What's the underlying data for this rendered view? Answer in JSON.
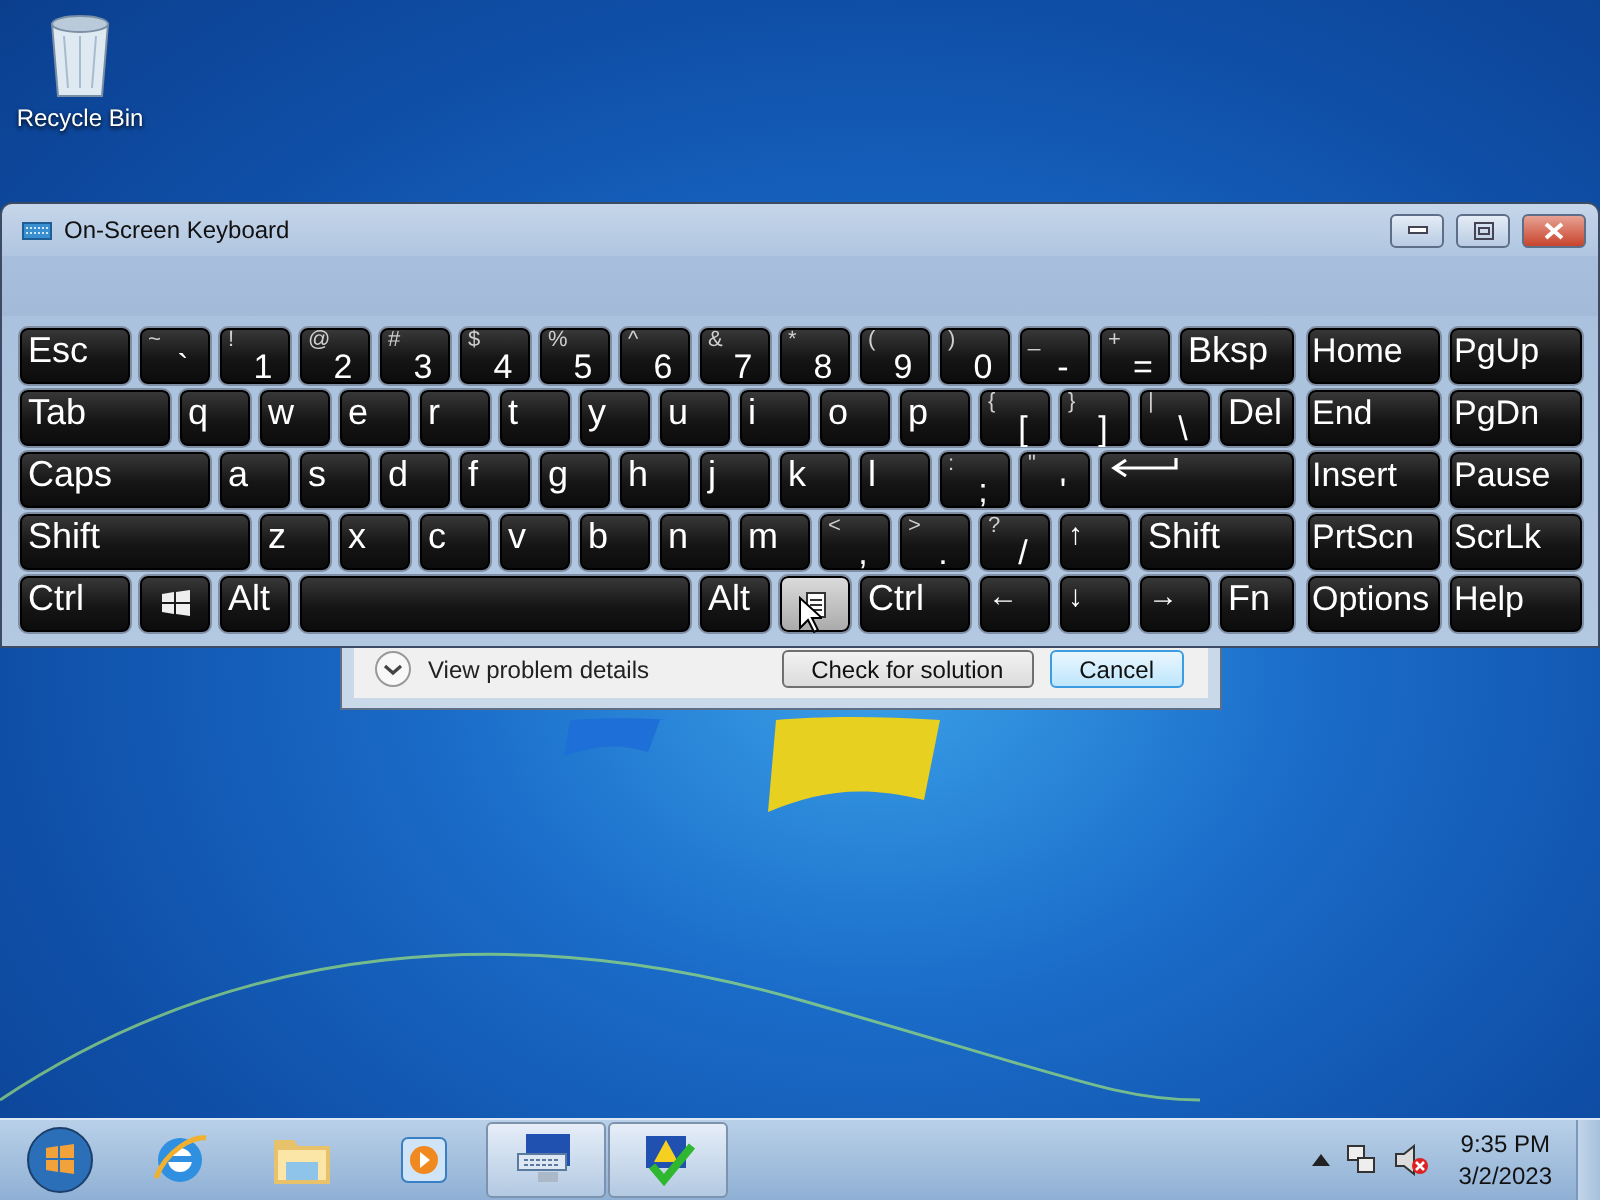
{
  "desktop_icons": [
    {
      "label": "Recycle Bin"
    }
  ],
  "keyboard_window": {
    "title": "On-Screen Keyboard",
    "key_rows": [
      {
        "keys": [
          {
            "kind": "text",
            "label": "Esc",
            "hovered": false
          },
          {
            "kind": "dual",
            "top": "~",
            "label": "`",
            "hovered": false
          },
          {
            "kind": "dual",
            "top": "!",
            "label": "1",
            "hovered": false
          },
          {
            "kind": "dual",
            "top": "@",
            "label": "2",
            "hovered": false
          },
          {
            "kind": "dual",
            "top": "#",
            "label": "3",
            "hovered": false
          },
          {
            "kind": "dual",
            "top": "$",
            "label": "4",
            "hovered": false
          },
          {
            "kind": "dual",
            "top": "%",
            "label": "5",
            "hovered": false
          },
          {
            "kind": "dual",
            "top": "^",
            "label": "6",
            "hovered": false
          },
          {
            "kind": "dual",
            "top": "&",
            "label": "7",
            "hovered": false
          },
          {
            "kind": "dual",
            "top": "*",
            "label": "8",
            "hovered": false
          },
          {
            "kind": "dual",
            "top": "(",
            "label": "9",
            "hovered": false
          },
          {
            "kind": "dual",
            "top": ")",
            "label": "0",
            "hovered": false
          },
          {
            "kind": "dual",
            "top": "_",
            "label": "-",
            "hovered": false
          },
          {
            "kind": "dual",
            "top": "+",
            "label": "=",
            "hovered": false
          },
          {
            "kind": "text",
            "label": "Bksp",
            "hovered": false
          }
        ]
      },
      {
        "keys": [
          {
            "kind": "text",
            "label": "Tab",
            "hovered": false
          },
          {
            "kind": "text",
            "label": "q",
            "hovered": false
          },
          {
            "kind": "text",
            "label": "w",
            "hovered": false
          },
          {
            "kind": "text",
            "label": "e",
            "hovered": false
          },
          {
            "kind": "text",
            "label": "r",
            "hovered": false
          },
          {
            "kind": "text",
            "label": "t",
            "hovered": false
          },
          {
            "kind": "text",
            "label": "y",
            "hovered": false
          },
          {
            "kind": "text",
            "label": "u",
            "hovered": false
          },
          {
            "kind": "text",
            "label": "i",
            "hovered": false
          },
          {
            "kind": "text",
            "label": "o",
            "hovered": false
          },
          {
            "kind": "text",
            "label": "p",
            "hovered": false
          },
          {
            "kind": "dual",
            "top": "{",
            "label": "[",
            "hovered": false
          },
          {
            "kind": "dual",
            "top": "}",
            "label": "]",
            "hovered": false
          },
          {
            "kind": "dual",
            "top": "|",
            "label": "\\",
            "hovered": false
          },
          {
            "kind": "text",
            "label": "Del",
            "hovered": false
          }
        ]
      },
      {
        "keys": [
          {
            "kind": "text",
            "label": "Caps",
            "hovered": false
          },
          {
            "kind": "text",
            "label": "a",
            "hovered": false
          },
          {
            "kind": "text",
            "label": "s",
            "hovered": false
          },
          {
            "kind": "text",
            "label": "d",
            "hovered": false
          },
          {
            "kind": "text",
            "label": "f",
            "hovered": false
          },
          {
            "kind": "text",
            "label": "g",
            "hovered": false
          },
          {
            "kind": "text",
            "label": "h",
            "hovered": false
          },
          {
            "kind": "text",
            "label": "j",
            "hovered": false
          },
          {
            "kind": "text",
            "label": "k",
            "hovered": false
          },
          {
            "kind": "text",
            "label": "l",
            "hovered": false
          },
          {
            "kind": "dual",
            "top": ":",
            "label": ";",
            "hovered": false
          },
          {
            "kind": "dual",
            "top": "\"",
            "label": "'",
            "hovered": false
          },
          {
            "kind": "enter",
            "hovered": false
          }
        ]
      },
      {
        "keys": [
          {
            "kind": "text",
            "label": "Shift",
            "hovered": false
          },
          {
            "kind": "text",
            "label": "z",
            "hovered": false
          },
          {
            "kind": "text",
            "label": "x",
            "hovered": false
          },
          {
            "kind": "text",
            "label": "c",
            "hovered": false
          },
          {
            "kind": "text",
            "label": "v",
            "hovered": false
          },
          {
            "kind": "text",
            "label": "b",
            "hovered": false
          },
          {
            "kind": "text",
            "label": "n",
            "hovered": false
          },
          {
            "kind": "text",
            "label": "m",
            "hovered": false
          },
          {
            "kind": "dual",
            "top": "<",
            "label": ",",
            "hovered": false
          },
          {
            "kind": "dual",
            "top": ">",
            "label": ".",
            "hovered": false
          },
          {
            "kind": "dual",
            "top": "?",
            "label": "/",
            "hovered": false
          },
          {
            "kind": "arrow",
            "label": "↑",
            "hovered": false
          },
          {
            "kind": "text",
            "label": "Shift",
            "hovered": false
          }
        ]
      },
      {
        "keys": [
          {
            "kind": "text",
            "label": "Ctrl",
            "hovered": false
          },
          {
            "kind": "windows",
            "hovered": false
          },
          {
            "kind": "text",
            "label": "Alt",
            "hovered": false
          },
          {
            "kind": "space",
            "hovered": false
          },
          {
            "kind": "text",
            "label": "Alt",
            "hovered": false
          },
          {
            "kind": "menu",
            "hovered": true
          },
          {
            "kind": "text",
            "label": "Ctrl",
            "hovered": false
          },
          {
            "kind": "arrow",
            "label": "←",
            "hovered": false
          },
          {
            "kind": "arrow",
            "label": "↓",
            "hovered": false
          },
          {
            "kind": "arrow",
            "label": "→",
            "hovered": false
          },
          {
            "kind": "text",
            "label": "Fn",
            "hovered": false
          }
        ]
      }
    ],
    "nav_keys": [
      {
        "label": "Home"
      },
      {
        "label": "PgUp"
      },
      {
        "label": "End"
      },
      {
        "label": "PgDn"
      },
      {
        "label": "Insert"
      },
      {
        "label": "Pause"
      },
      {
        "label": "PrtScn"
      },
      {
        "label": "ScrLk"
      },
      {
        "label": "Options"
      },
      {
        "label": "Help"
      }
    ]
  },
  "dialog": {
    "details_link": "View problem details",
    "buttons": [
      {
        "label": "Check for solution",
        "selected": false
      },
      {
        "label": "Cancel",
        "selected": true
      }
    ]
  },
  "taskbar": {
    "apps": [
      {
        "kind": "browser",
        "active": false
      },
      {
        "kind": "folder",
        "active": false
      },
      {
        "kind": "media",
        "active": false
      },
      {
        "kind": "keyboard",
        "active": true
      },
      {
        "kind": "flag",
        "active": true
      }
    ],
    "clock": {
      "time": "9:35 PM",
      "date": "3/2/2023"
    }
  }
}
